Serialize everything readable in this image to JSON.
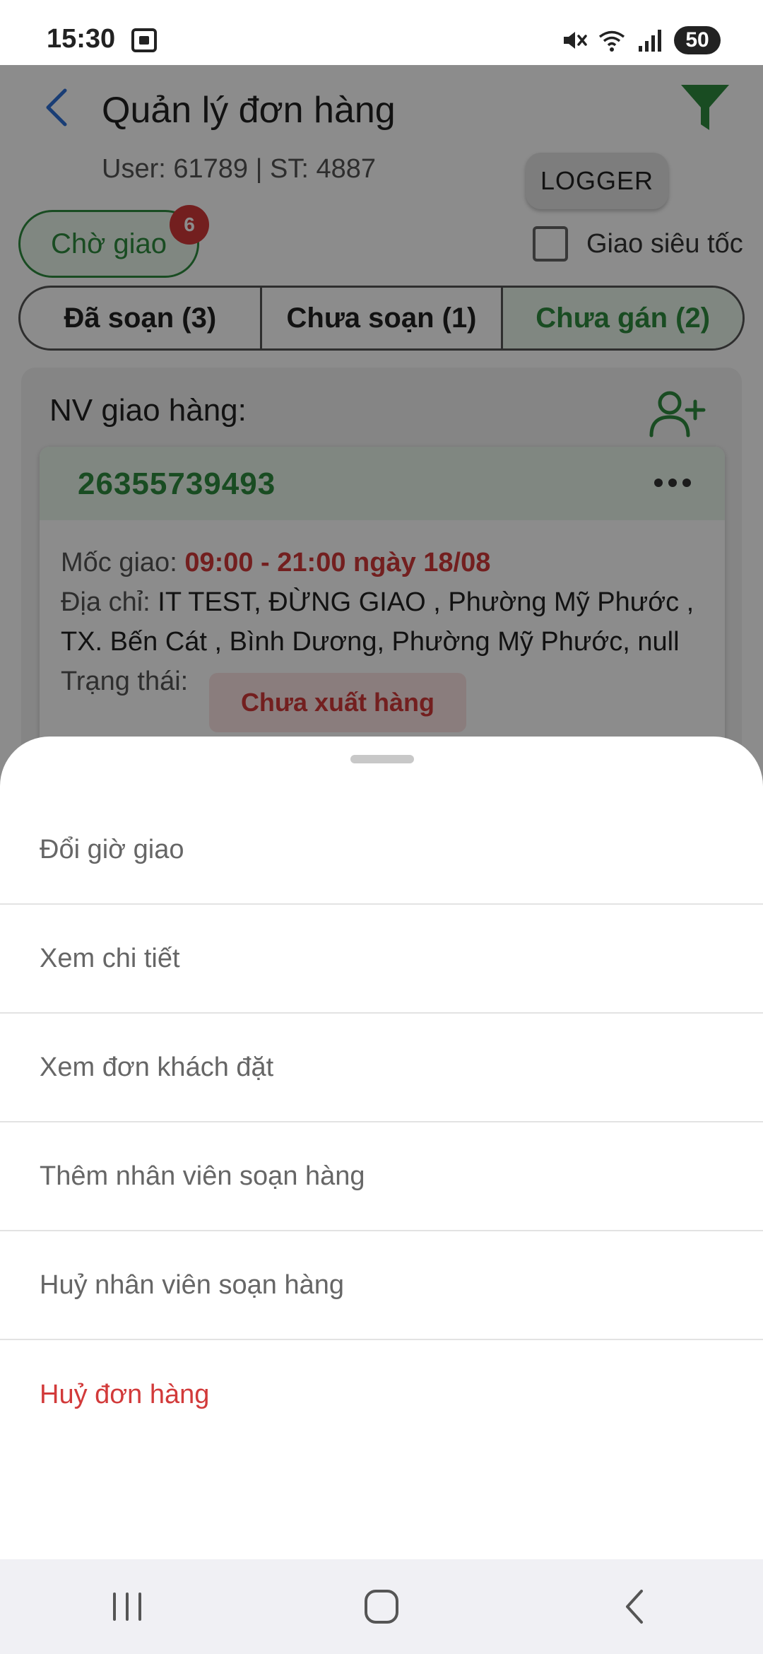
{
  "status_bar": {
    "time": "15:30",
    "battery": "50",
    "icons": [
      "screenshot-icon",
      "mute-icon",
      "wifi-icon",
      "signal-icon"
    ]
  },
  "header": {
    "title": "Quản lý đơn hàng",
    "user_info": "User: 61789 | ST: 4887",
    "logger_label": "LOGGER"
  },
  "filters": {
    "status_chip_label": "Chờ giao",
    "status_chip_count": "6",
    "express_label": "Giao siêu tốc",
    "express_checked": false
  },
  "tabs": [
    {
      "label": "Đã soạn (3)",
      "active": false
    },
    {
      "label": "Chưa soạn (1)",
      "active": false
    },
    {
      "label": "Chưa gán (2)",
      "active": true
    }
  ],
  "panel": {
    "shipper_label": "NV giao hàng:"
  },
  "order": {
    "id": "26355739493",
    "time_label": "Mốc giao: ",
    "time_value": "09:00 - 21:00 ngày 18/08",
    "address_label": "Địa chỉ: ",
    "address_value": "IT TEST, ĐỪNG GIAO , Phường Mỹ Phước , TX. Bến Cát , Bình Dương, Phường Mỹ Phước, null",
    "status_label": "Trạng thái:",
    "status_value": "Chưa xuất hàng"
  },
  "sheet": {
    "items": [
      {
        "label": "Đổi giờ giao"
      },
      {
        "label": "Xem chi tiết"
      },
      {
        "label": "Xem đơn khách đặt"
      },
      {
        "label": "Thêm nhân viên soạn hàng"
      },
      {
        "label": "Huỷ nhân viên soạn hàng"
      },
      {
        "label": "Huỷ đơn hàng"
      }
    ]
  },
  "colors": {
    "accent_green": "#2e8b3e",
    "danger_red": "#d23a3a",
    "back_blue": "#2f6fd6"
  }
}
